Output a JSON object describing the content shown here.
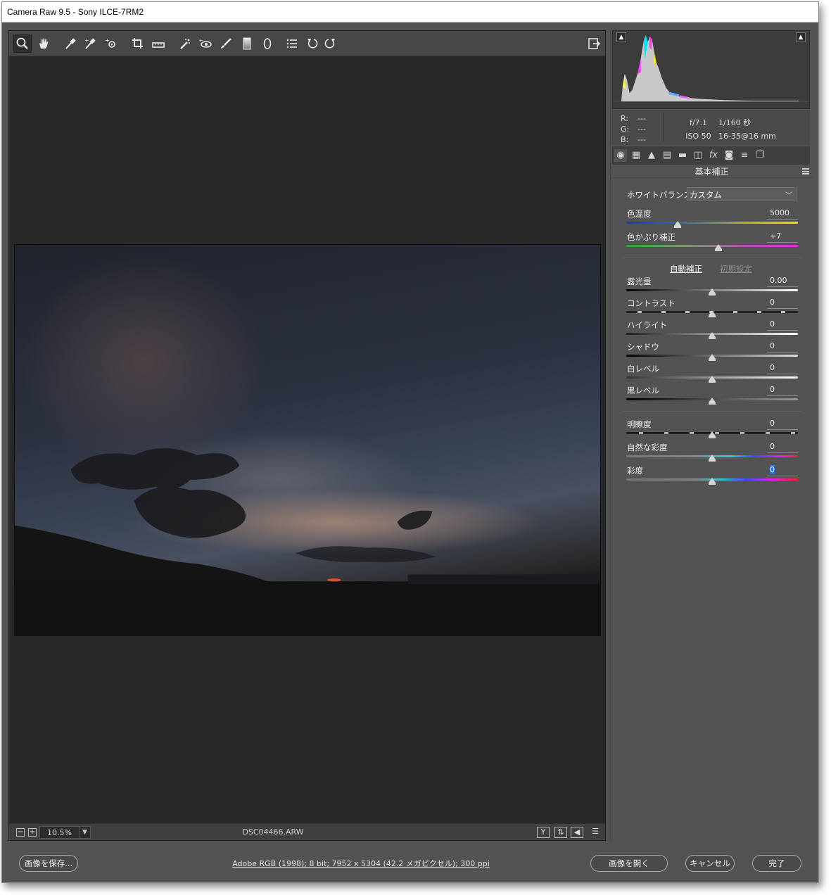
{
  "window": {
    "title": "Camera Raw 9.5  -  Sony ILCE-7RM2"
  },
  "toolbar": {
    "tools": [
      "zoom-icon",
      "hand-icon",
      "white-balance-icon",
      "color-sampler-icon",
      "targeted-adjustment-icon",
      "crop-icon",
      "straighten-icon",
      "spot-removal-icon",
      "red-eye-icon",
      "adjustment-brush-icon",
      "graduated-filter-icon",
      "radial-filter-icon",
      "preferences-icon",
      "rotate-ccw-icon",
      "rotate-cw-icon"
    ],
    "fullscreen_icon": "fullscreen-icon"
  },
  "status": {
    "zoom_out": "−",
    "zoom_in": "+",
    "zoom_value": "10.5%",
    "filename": "DSC04466.ARW",
    "view_y": "Y",
    "view_icons": [
      "before-after-icon",
      "swap-icon",
      "settings-sliders-icon"
    ]
  },
  "histogram": {
    "shadow_clip_icon": "shadow-clipping-icon",
    "highlight_clip_icon": "highlight-clipping-icon"
  },
  "readout": {
    "r_label": "R:",
    "r_value": "---",
    "g_label": "G:",
    "g_value": "---",
    "b_label": "B:",
    "b_value": "---",
    "aperture": "f/7.1",
    "shutter": "1/160 秒",
    "iso": "ISO 50",
    "lens": "16-35@16 mm"
  },
  "panel_tabs": [
    "basic-icon",
    "tone-curve-icon",
    "detail-icon",
    "hsl-icon",
    "split-toning-icon",
    "lens-corrections-icon",
    "effects-icon",
    "camera-calibration-icon",
    "presets-icon",
    "snapshots-icon"
  ],
  "panel": {
    "title": "基本補正",
    "wb_label": "ホワイトバランス：",
    "wb_value": "カスタム",
    "auto": "自動補正",
    "default": "初期設定"
  },
  "sliders": {
    "temp": {
      "label": "色温度",
      "value": "5000",
      "level": 0.3
    },
    "tint": {
      "label": "色かぶり補正",
      "value": "+7",
      "level": 0.535
    },
    "exposure": {
      "label": "露光量",
      "value": "0.00",
      "level": 0.5
    },
    "contrast": {
      "label": "コントラスト",
      "value": "0",
      "level": 0.5
    },
    "highlights": {
      "label": "ハイライト",
      "value": "0",
      "level": 0.5
    },
    "shadows": {
      "label": "シャドウ",
      "value": "0",
      "level": 0.5
    },
    "whites": {
      "label": "白レベル",
      "value": "0",
      "level": 0.5
    },
    "blacks": {
      "label": "黒レベル",
      "value": "0",
      "level": 0.5
    },
    "clarity": {
      "label": "明瞭度",
      "value": "0",
      "level": 0.5
    },
    "vibrance": {
      "label": "自然な彩度",
      "value": "0",
      "level": 0.5
    },
    "saturation": {
      "label": "彩度",
      "value": "0",
      "level": 0.5
    }
  },
  "footer": {
    "save": "画像を保存...",
    "workflow": "Adobe RGB (1998); 8 bit; 7952 x 5304 (42.2 メガピクセル); 300 ppi",
    "open": "画像を開く",
    "cancel": "キャンセル",
    "done": "完了"
  }
}
